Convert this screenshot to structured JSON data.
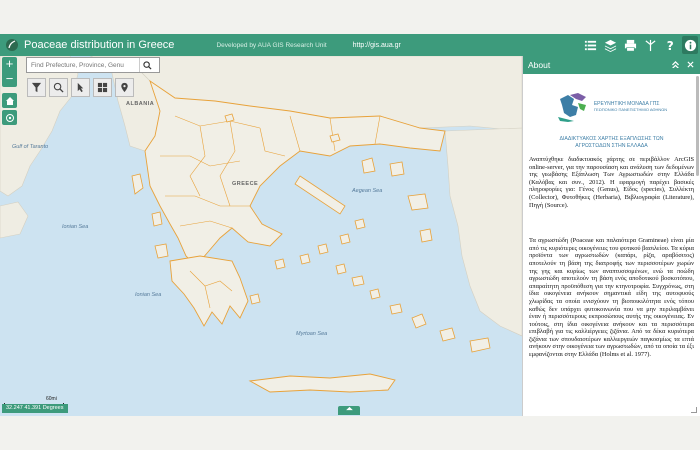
{
  "header": {
    "title": "Poaceae distribution in Greece",
    "developer": "Developed by AUA GIS Research Unit",
    "url": "http://gis.aua.gr"
  },
  "search": {
    "placeholder": "Find Prefecture, Province, Genu"
  },
  "zoom": {
    "in": "+",
    "out": "−"
  },
  "map_labels": {
    "albania": "ALBANIA",
    "greece": "GREECE",
    "gulf_taranto": "Gulf of Taranto",
    "ionian": "Ionian Sea",
    "myrtoan": "Myrtoan Sea",
    "aegean": "Aegean Sea",
    "ionian2": "Ionian Sea"
  },
  "scale": {
    "label": "60mi"
  },
  "coords": {
    "text": "32.247 41.391 Degrees"
  },
  "panel": {
    "title": "About",
    "logo_line1": "ΕΡΕΥΝΗΤΙΚΗ ΜΟΝΑΔΑ ΓΠΣ",
    "logo_line2": "ΓΕΩΠΟΝΙΚΟ ΠΑΝΕΠΙΣΤΗΜΙΟ ΑΘΗΝΩΝ",
    "subtitle1": "ΔΙΑΔΙΚΤΥΑΚΟΣ ΧΑΡΤΗΣ ΕΞΑΠΛΩΣΗΣ ΤΩΝ",
    "subtitle2": "ΑΓΡΩΣΤΩΔΩΝ ΣΤΗΝ ΕΛΛΑΔΑ",
    "para1": "Αναπτύχθηκε διαδικτυακός χάρτης σε περιβάλλον ArcGIS online-server, για την παρουσίαση και ανάλυση των δεδομένων της γεωβάσης Εξάπλωση Των Αγρωστωδών στην Ελλάδα (Καλόβας και συν., 2012). Η εφαρμογή παρέχει βασικές πληροφορίες για: Γένος (Genus), Είδος (species), Συλλέκτη (Collector), Φυτοθήκες (Herbaria), Βιβλιογραφία (Literature), Πηγή (Source).",
    "para2": "Τα αγρωστώδη (Poaceae και παλαιότερα Gramineae) είναι μία από τις κυριότερες οικογένειες του φυτικού βασιλείου. Τα κύρια προϊόντα των αγρωστωδών (καπάρι, ρίζα, αραβόσιτος) αποτελούν τη βάση της διατροφής των περισσοτέρων χωρών της γης και κυρίως των αναπτυσσομένων, ενώ τα ποώδη αγρωστώδη αποτελούν τη βάση ενός αποδοτικού βοσκοτόπου, απαραίτητη προϋπόθεση για την κτηνοτροφία. Συγχρόνως, στη ίδια οικογένεια ανήκουν σημαντικά είδη της αυτοφυούς χλωρίδας τα οποία ενισχύουν τη βιοποικιλότητα ενός τόπου καθώς δεν υπάρχει φυτοκοινωνία που να μην περιλαμβάνει έναν ή περισσότερους εκπροσώπους αυτής της οικογένειας. Εν τούτοις, στη ίδια οικογένεια ανήκουν και τα περισσότερα επιβλαβή για τις καλλιέργειες ζιζάνια. Από τα δέκα κυριότερα ζιζάνια των σπουδαιοτέρων καλλιεργειών παγκοσμίως τα επτά ανήκουν στην οικογένεια των αγρωστωδών, από τα οποία τα έξι εμφανίζονται στην Ελλάδα (Holms et al. 1977)."
  },
  "colors": {
    "accent": "#3d9b7c",
    "sea": "#cde3f1",
    "land": "#f1efe6",
    "boundary": "#e8a23a"
  }
}
